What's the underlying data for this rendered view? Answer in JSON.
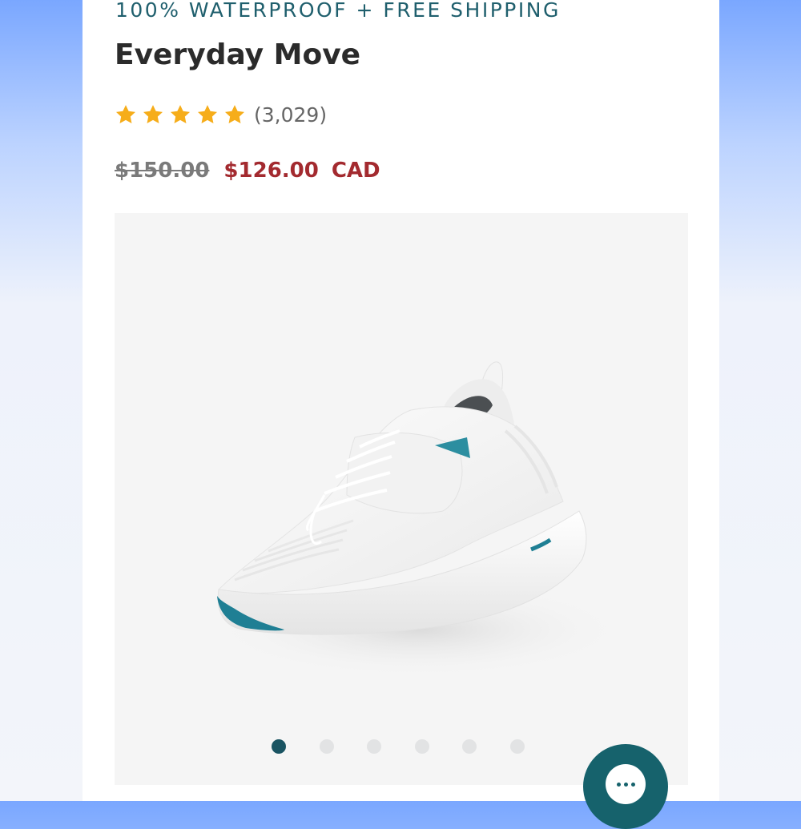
{
  "promo": {
    "text": "100% WATERPROOF + FREE SHIPPING"
  },
  "product": {
    "name": "Everyday Move",
    "rating": {
      "stars": 5,
      "max_stars": 5,
      "review_count": "(3,029)"
    },
    "price": {
      "original": "$150.00",
      "sale": "$126.00",
      "currency": "CAD"
    }
  },
  "gallery": {
    "image_icon": "sneaker-image",
    "slide_count": 6,
    "active_slide": 1
  },
  "chat": {
    "icon": "chat-bubble-icon"
  },
  "colors": {
    "promo_text": "#1f5f6d",
    "title_text": "#2b2b2b",
    "star": "#f6ad1a",
    "sale_price": "#a32a2f",
    "old_price": "#7a7a7a",
    "active_dot": "#1a5462",
    "inactive_dot": "#e2e3e4",
    "chat_button": "#16626c"
  }
}
